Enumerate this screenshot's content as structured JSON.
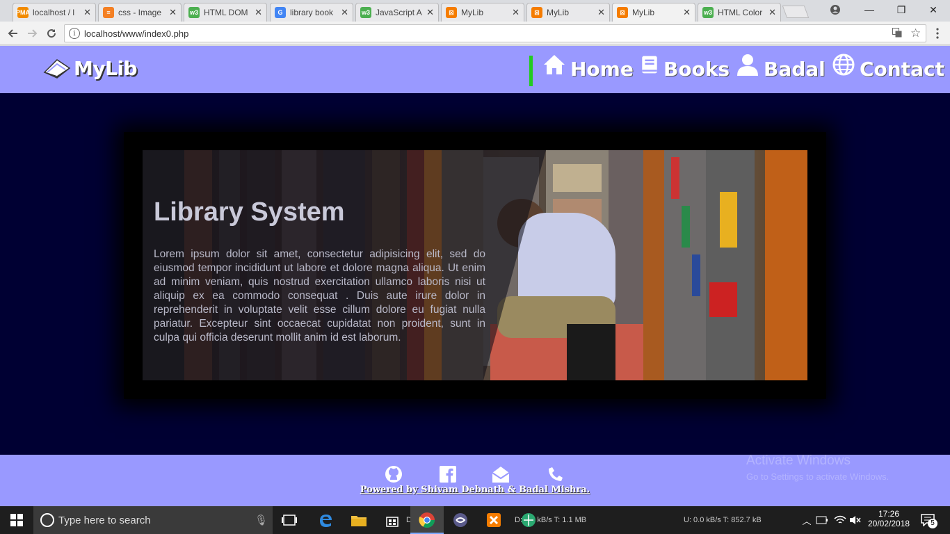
{
  "browser": {
    "tabs": [
      {
        "title": "localhost / l",
        "fav_color": "#f28b00",
        "fav_text": "PMA"
      },
      {
        "title": "css - Image",
        "fav_color": "#f48024",
        "fav_text": "≡"
      },
      {
        "title": "HTML DOM",
        "fav_color": "#4caf50",
        "fav_text": "w3"
      },
      {
        "title": "library book",
        "fav_color": "#4285f4",
        "fav_text": "G"
      },
      {
        "title": "JavaScript A",
        "fav_color": "#4caf50",
        "fav_text": "w3"
      },
      {
        "title": "MyLib",
        "fav_color": "#f57c00",
        "fav_text": "⊠"
      },
      {
        "title": "MyLib",
        "fav_color": "#f57c00",
        "fav_text": "⊠"
      },
      {
        "title": "MyLib",
        "fav_color": "#f57c00",
        "fav_text": "⊠"
      },
      {
        "title": "HTML Color",
        "fav_color": "#4caf50",
        "fav_text": "w3"
      }
    ],
    "close_glyph": "✕",
    "url": "localhost/www/index0.php",
    "window_controls": {
      "minimize": "—",
      "maximize": "❐",
      "close": "✕"
    }
  },
  "site": {
    "logo_text": "MyLib",
    "nav": [
      {
        "label": "Home",
        "icon": "home-icon"
      },
      {
        "label": "Books",
        "icon": "book-icon"
      },
      {
        "label": "Badal",
        "icon": "user-icon"
      },
      {
        "label": "Contact",
        "icon": "globe-icon"
      }
    ],
    "hero": {
      "title": "Library System",
      "text": "Lorem ipsum dolor sit amet, consectetur adipisicing elit, sed do eiusmod tempor incididunt ut labore et dolore magna aliqua. Ut enim ad minim veniam, quis nostrud exercitation ullamco laboris nisi ut aliquip ex ea commodo consequat . Duis aute irure dolor in reprehenderit in voluptate velit esse cillum dolore eu fugiat nulla pariatur. Excepteur sint occaecat cupidatat non proident, sunt in culpa qui officia deserunt mollit anim id est laborum."
    },
    "footer": {
      "social": [
        "github-icon",
        "facebook-icon",
        "mail-icon",
        "phone-icon"
      ],
      "powered_by": "Powered by Shivam Debnath & Badal Mishra."
    },
    "colors": {
      "header_bg": "#9999ff",
      "page_bg": "#000033",
      "nav_separator": "#22cc22"
    }
  },
  "watermark": {
    "line1": "Activate Windows",
    "line2": "Go to Settings to activate Windows."
  },
  "taskbar": {
    "search_placeholder": "Type here to search",
    "net_down": "D: 0.0 kB/s T: 1.1 MB",
    "net_up": "U: 0.0 kB/s T: 852.7 kB",
    "net_prefix": "DH",
    "time": "17:26",
    "date": "20/02/2018",
    "notification_count": "5"
  }
}
